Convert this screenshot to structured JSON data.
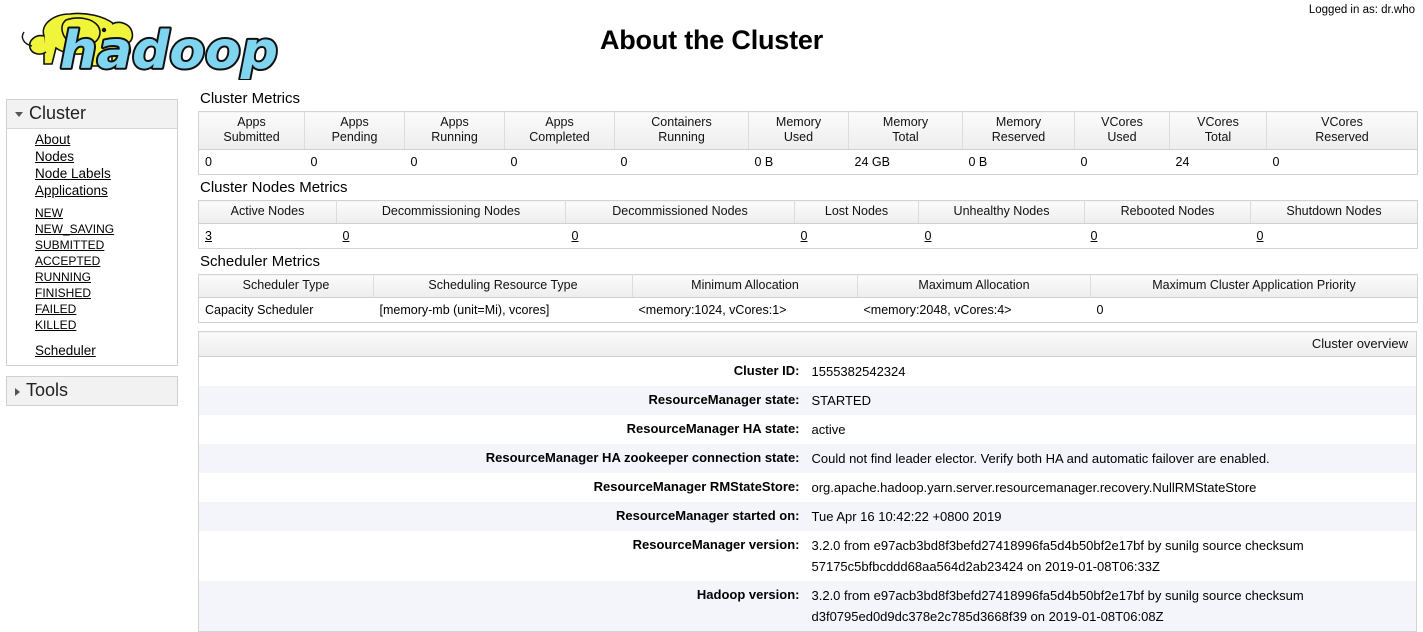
{
  "header": {
    "title": "About the Cluster",
    "login_text": "Logged in as: dr.who",
    "logo_alt": "hadoop"
  },
  "sidebar": {
    "cluster": {
      "title": "Cluster",
      "expanded": true,
      "items": [
        {
          "label": "About"
        },
        {
          "label": "Nodes"
        },
        {
          "label": "Node Labels"
        },
        {
          "label": "Applications"
        }
      ],
      "application_states": [
        {
          "label": "NEW"
        },
        {
          "label": "NEW_SAVING"
        },
        {
          "label": "SUBMITTED"
        },
        {
          "label": "ACCEPTED"
        },
        {
          "label": "RUNNING"
        },
        {
          "label": "FINISHED"
        },
        {
          "label": "FAILED"
        },
        {
          "label": "KILLED"
        }
      ],
      "scheduler": {
        "label": "Scheduler"
      }
    },
    "tools": {
      "title": "Tools",
      "expanded": false
    }
  },
  "cluster_metrics": {
    "title": "Cluster Metrics",
    "columns": [
      {
        "line1": "Apps",
        "line2": "Submitted"
      },
      {
        "line1": "Apps",
        "line2": "Pending"
      },
      {
        "line1": "Apps",
        "line2": "Running"
      },
      {
        "line1": "Apps",
        "line2": "Completed"
      },
      {
        "line1": "Containers",
        "line2": "Running"
      },
      {
        "line1": "Memory",
        "line2": "Used"
      },
      {
        "line1": "Memory",
        "line2": "Total"
      },
      {
        "line1": "Memory",
        "line2": "Reserved"
      },
      {
        "line1": "VCores",
        "line2": "Used"
      },
      {
        "line1": "VCores",
        "line2": "Total"
      },
      {
        "line1": "VCores",
        "line2": "Reserved"
      }
    ],
    "values": [
      "0",
      "0",
      "0",
      "0",
      "0",
      "0 B",
      "24 GB",
      "0 B",
      "0",
      "24",
      "0"
    ]
  },
  "cluster_nodes_metrics": {
    "title": "Cluster Nodes Metrics",
    "columns": [
      "Active Nodes",
      "Decommissioning Nodes",
      "Decommissioned Nodes",
      "Lost Nodes",
      "Unhealthy Nodes",
      "Rebooted Nodes",
      "Shutdown Nodes"
    ],
    "values": [
      "3",
      "0",
      "0",
      "0",
      "0",
      "0",
      "0"
    ]
  },
  "scheduler_metrics": {
    "title": "Scheduler Metrics",
    "columns": [
      "Scheduler Type",
      "Scheduling Resource Type",
      "Minimum Allocation",
      "Maximum Allocation",
      "Maximum Cluster Application Priority"
    ],
    "values": [
      "Capacity Scheduler",
      "[memory-mb (unit=Mi), vcores]",
      "<memory:1024, vCores:1>",
      "<memory:2048, vCores:4>",
      "0"
    ]
  },
  "cluster_overview": {
    "header": "Cluster overview",
    "rows": [
      {
        "label": "Cluster ID:",
        "value": "1555382542324"
      },
      {
        "label": "ResourceManager state:",
        "value": "STARTED"
      },
      {
        "label": "ResourceManager HA state:",
        "value": "active"
      },
      {
        "label": "ResourceManager HA zookeeper connection state:",
        "value": "Could not find leader elector. Verify both HA and automatic failover are enabled."
      },
      {
        "label": "ResourceManager RMStateStore:",
        "value": "org.apache.hadoop.yarn.server.resourcemanager.recovery.NullRMStateStore"
      },
      {
        "label": "ResourceManager started on:",
        "value": "Tue Apr 16 10:42:22 +0800 2019"
      },
      {
        "label": "ResourceManager version:",
        "value": "3.2.0 from e97acb3bd8f3befd27418996fa5d4b50bf2e17bf by sunilg source checksum 57175c5bfbcddd68aa564d2ab23424 on 2019-01-08T06:33Z"
      },
      {
        "label": "Hadoop version:",
        "value": "3.2.0 from e97acb3bd8f3befd27418996fa5d4b50bf2e17bf by sunilg source checksum d3f0795ed0d9dc378e2c785d3668f39 on 2019-01-08T06:08Z"
      }
    ]
  },
  "colors": {
    "logo_elephant": "#f0f53c",
    "logo_text": "#7fd4f0",
    "row_alt": "#f4f4fb",
    "header_bg": "#ededed"
  }
}
